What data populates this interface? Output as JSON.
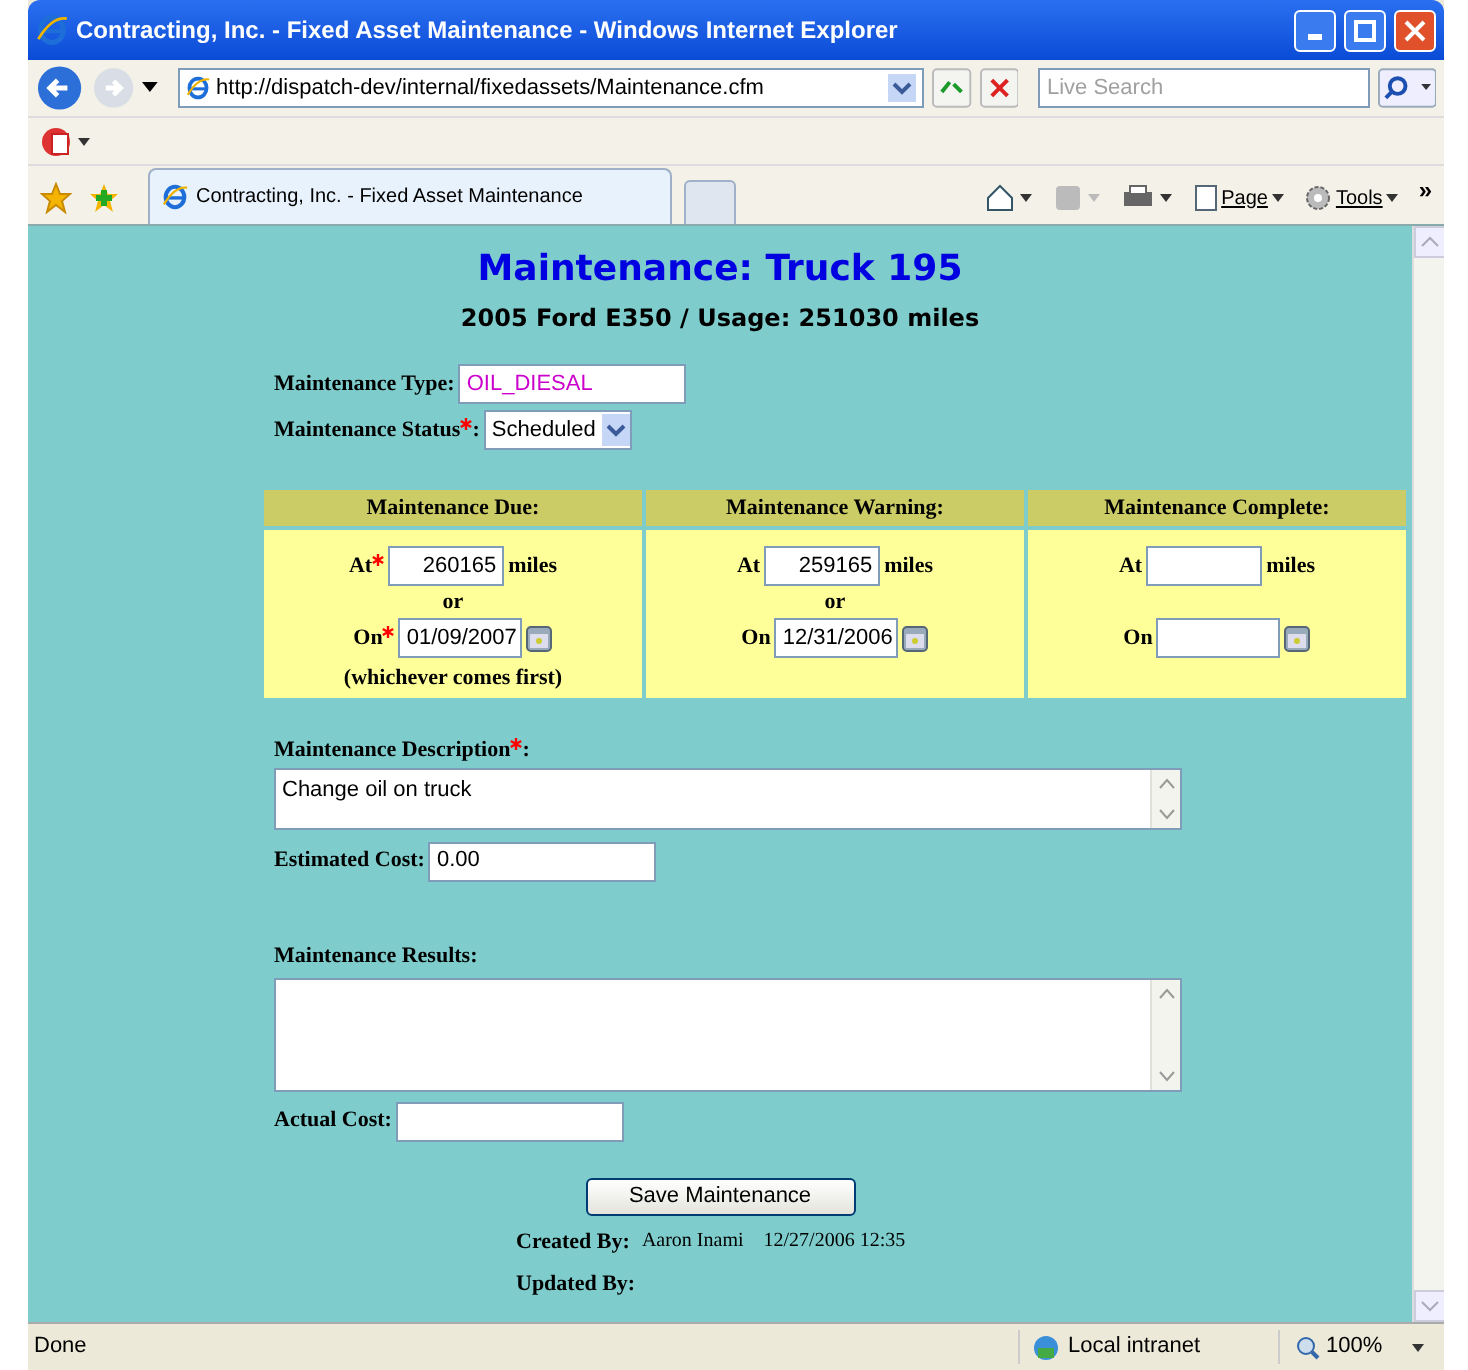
{
  "window": {
    "title": "Contracting, Inc. - Fixed Asset Maintenance - Windows Internet Explorer"
  },
  "address_bar": {
    "url": "http://dispatch-dev/internal/fixedassets/Maintenance.cfm"
  },
  "search": {
    "placeholder": "Live Search"
  },
  "tabs": [
    {
      "label": "Contracting, Inc. - Fixed Asset Maintenance",
      "selected": true
    }
  ],
  "command_bar": {
    "page": "Page",
    "tools": "Tools",
    "more": "»"
  },
  "page": {
    "title": "Maintenance: Truck 195",
    "subtitle": "2005 Ford E350 / Usage: 251030 miles",
    "fields": [
      {
        "kind": "text",
        "label": "Maintenance Type:",
        "required": false,
        "value": "OIL_DIESAL"
      },
      {
        "kind": "select",
        "label": "Maintenance Status",
        "required": true,
        "colon": ":",
        "value": "Scheduled"
      }
    ],
    "schedule": [
      {
        "heading": "Maintenance Due:",
        "at_label": "At",
        "at_required": true,
        "miles": "260165",
        "miles_unit": "miles",
        "or": "or",
        "on_label": "On",
        "on_required": true,
        "date": "01/09/2007",
        "note": "(whichever comes first)"
      },
      {
        "heading": "Maintenance Warning:",
        "at_label": "At",
        "at_required": false,
        "miles": "259165",
        "miles_unit": "miles",
        "or": "or",
        "on_label": "On",
        "on_required": false,
        "date": "12/31/2006"
      },
      {
        "heading": "Maintenance Complete:",
        "at_label": "At",
        "at_required": false,
        "miles_unit": "miles",
        "on_label": "On",
        "on_required": false
      }
    ],
    "description": {
      "label": "Maintenance Description",
      "required": true,
      "colon": ":",
      "value": "Change oil on truck"
    },
    "estimated_cost": {
      "label": "Estimated Cost:",
      "value": "0.00"
    },
    "results": {
      "label": "Maintenance Results:"
    },
    "actual_cost": {
      "label": "Actual Cost:"
    },
    "save_button": "Save Maintenance",
    "created_by": {
      "label": "Created By:",
      "name": "Aaron Inami",
      "time": "12/27/2006 12:35"
    },
    "updated_by": {
      "label": "Updated By:"
    }
  },
  "status_bar": {
    "status": "Done",
    "zone": "Local intranet",
    "zoom": "100%"
  }
}
